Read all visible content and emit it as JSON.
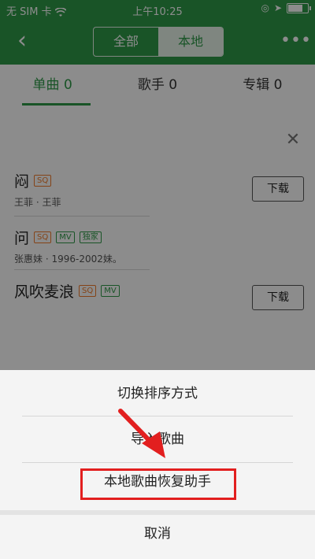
{
  "status_bar": {
    "carrier": "无 SIM 卡",
    "time": "上午10:25"
  },
  "nav": {
    "back_icon": "chevron-left-icon",
    "segments": [
      "全部",
      "本地"
    ],
    "active_segment": 1,
    "more_icon": "more-dots-icon"
  },
  "tabs": {
    "items": [
      "单曲 0",
      "歌手 0",
      "专辑 0"
    ],
    "active": 0
  },
  "songs": [
    {
      "title": "闷",
      "badges": [
        "SQ"
      ],
      "meta": "王菲 · 王菲",
      "download": "下载"
    },
    {
      "title": "问",
      "badges": [
        "SQ",
        "MV",
        "独家"
      ],
      "meta": "张惠妹 · 1996-2002妹。",
      "download": ""
    },
    {
      "title": "风吹麦浪",
      "badges": [
        "SQ",
        "MV"
      ],
      "meta": "",
      "download": "下载"
    }
  ],
  "action_sheet": {
    "items": [
      "切换排序方式",
      "导入歌曲",
      "本地歌曲恢复助手"
    ],
    "cancel": "取消"
  },
  "colors": {
    "brand": "#2e9a48",
    "highlight": "#e21f1f",
    "sq": "#f07b2a"
  }
}
